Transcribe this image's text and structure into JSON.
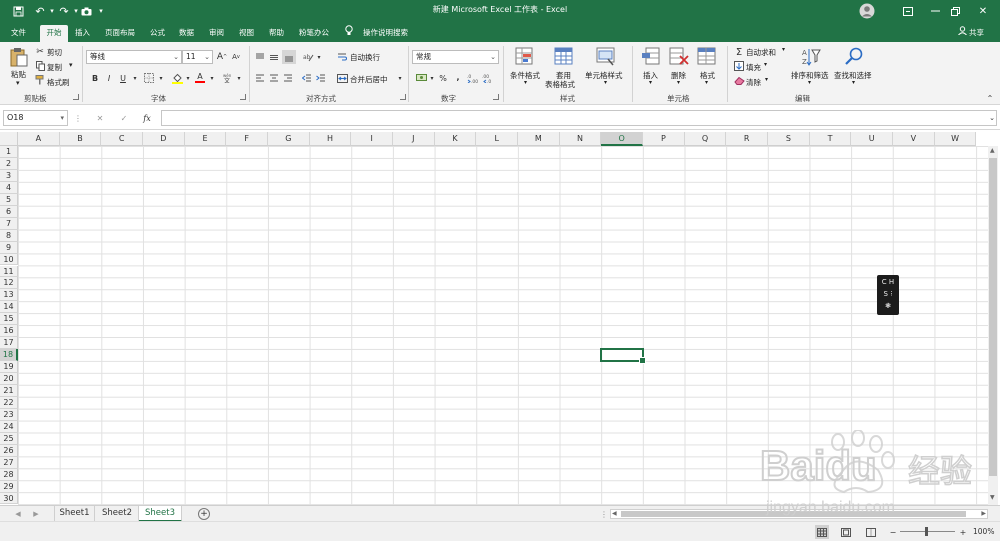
{
  "title": "新建 Microsoft Excel 工作表 - Excel",
  "tabs": [
    "文件",
    "开始",
    "插入",
    "页面布局",
    "公式",
    "数据",
    "审阅",
    "视图",
    "帮助",
    "粉笔办公"
  ],
  "tell_me": "操作说明搜索",
  "share": "共享",
  "clipboard": {
    "paste": "粘贴",
    "cut": "剪切",
    "copy": "复制",
    "format_painter": "格式刷",
    "label": "剪贴板"
  },
  "font": {
    "name": "等线",
    "size": "11",
    "bold": "B",
    "italic": "I",
    "underline": "U",
    "grow": "A",
    "shrink": "A",
    "color_a": "A",
    "label": "字体"
  },
  "alignment": {
    "wrap": "自动换行",
    "merge": "合并后居中",
    "label": "对齐方式"
  },
  "number": {
    "format": "常规",
    "percent": "%",
    "comma": ",",
    "label": "数字"
  },
  "styles": {
    "conditional": "条件格式",
    "table_line1": "套用",
    "table_line2": "表格格式",
    "cell_styles": "单元格样式",
    "label": "样式"
  },
  "cells": {
    "insert": "插入",
    "delete": "删除",
    "format": "格式",
    "label": "单元格"
  },
  "editing": {
    "autosum": "自动求和",
    "fill": "填充",
    "clear": "清除",
    "sort": "排序和筛选",
    "find": "查找和选择",
    "label": "编辑"
  },
  "formula_bar": {
    "name_box": "O18",
    "fx": "fx",
    "value": ""
  },
  "columns": [
    "A",
    "B",
    "C",
    "D",
    "E",
    "F",
    "G",
    "H",
    "I",
    "J",
    "K",
    "L",
    "M",
    "N",
    "O",
    "P",
    "Q",
    "R",
    "S",
    "T",
    "U",
    "V",
    "W"
  ],
  "rows": [
    "1",
    "2",
    "3",
    "4",
    "5",
    "6",
    "7",
    "8",
    "9",
    "10",
    "11",
    "12",
    "13",
    "14",
    "15",
    "16",
    "17",
    "18",
    "19",
    "20",
    "21",
    "22",
    "23",
    "24",
    "25",
    "26",
    "27",
    "28",
    "29",
    "30"
  ],
  "selected": {
    "column": "O",
    "row": "18"
  },
  "sheets": [
    "Sheet1",
    "Sheet2",
    "Sheet3"
  ],
  "active_sheet": "Sheet3",
  "zoom": "100%",
  "ime": {
    "line1": "C H",
    "line2": "S ⁝"
  },
  "watermark": {
    "brand": "Baidu",
    "jingyan": "经验",
    "url": "jingyan.baidu.com"
  },
  "colors": {
    "excel_green": "#217346",
    "ribbon_bg": "#f3f3f3",
    "grid_line": "#e1e1e1"
  }
}
